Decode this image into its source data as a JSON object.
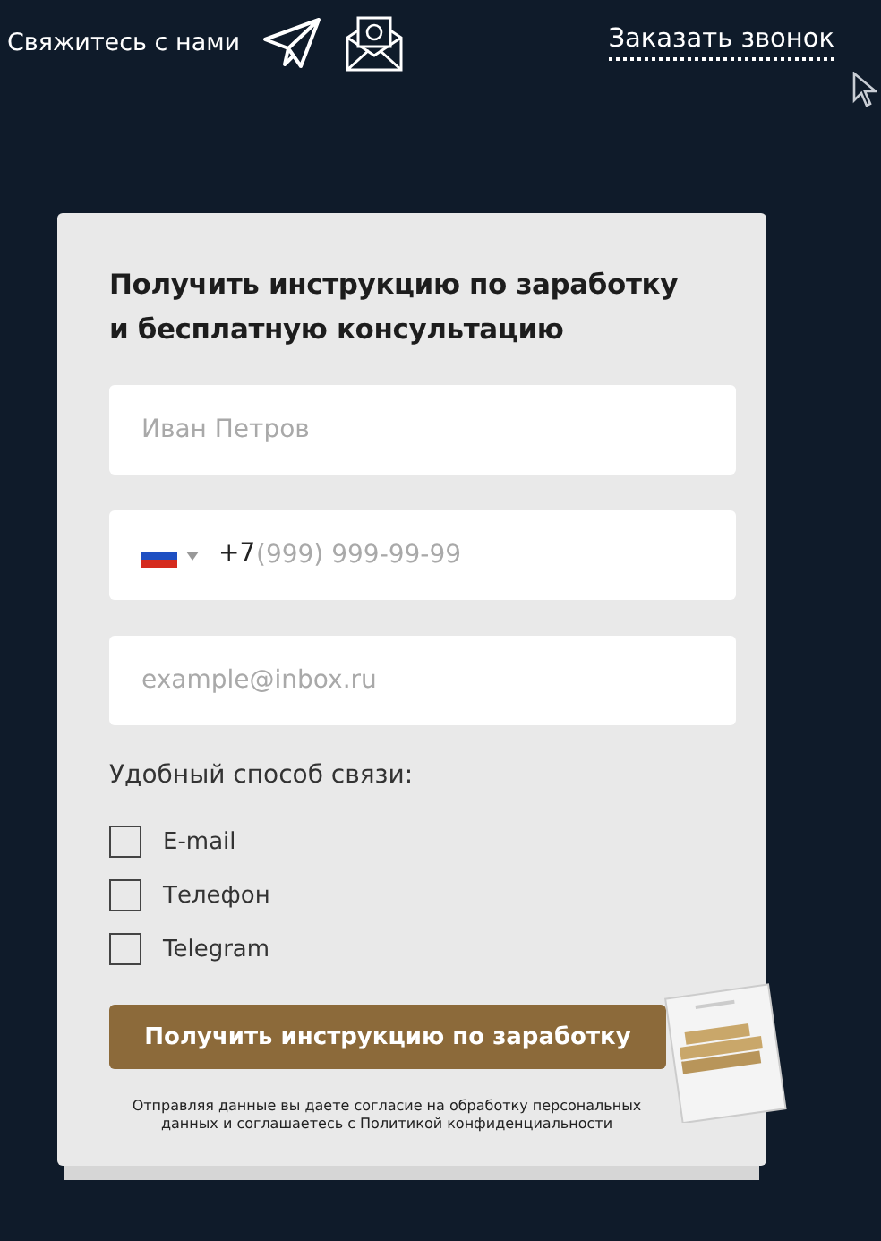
{
  "header": {
    "contact_label": "Свяжитесь с нами",
    "callback_link": "Заказать звонок"
  },
  "form": {
    "title": "Получить инструкцию по заработку и бесплатную консультацию",
    "name_field": {
      "placeholder": "Иван Петров"
    },
    "phone_field": {
      "prefix": "+7",
      "placeholder": "(999) 999-99-99"
    },
    "email_field": {
      "placeholder": "example@inbox.ru"
    },
    "contact_method_label": "Удобный способ связи:",
    "options": [
      {
        "label": "E-mail",
        "checked": false
      },
      {
        "label": "Телефон",
        "checked": false
      },
      {
        "label": "Telegram",
        "checked": false
      }
    ],
    "submit_button": "Получить инструкцию по заработку",
    "consent_text": "Отправляя данные вы даете согласие на обработку персональных данных и соглашаетесь с Политикой конфиденциальности"
  }
}
